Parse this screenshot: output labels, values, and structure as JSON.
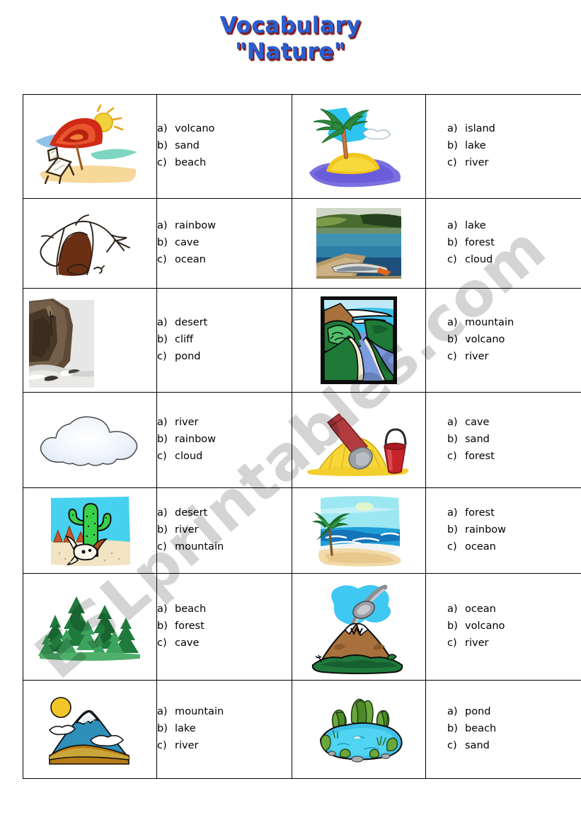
{
  "title": {
    "line1": "Vocabulary",
    "line2": "\"Nature\"",
    "color": "#2a5fd0",
    "shadow_color": "#8d1b1b"
  },
  "watermark": {
    "text": "ESLprintables.com",
    "color": "rgba(0,0,0,0.17)"
  },
  "rows": [
    {
      "left": {
        "image_name": "beach-umbrella-illustration",
        "options": [
          {
            "key": "a)",
            "word": "volcano"
          },
          {
            "key": "b)",
            "word": "sand"
          },
          {
            "key": "c)",
            "word": "beach"
          }
        ]
      },
      "right": {
        "image_name": "island-palm-tree-illustration",
        "options": [
          {
            "key": "a)",
            "word": "island"
          },
          {
            "key": "b)",
            "word": "lake"
          },
          {
            "key": "c)",
            "word": "river"
          }
        ]
      }
    },
    {
      "left": {
        "image_name": "cave-entrance-illustration",
        "options": [
          {
            "key": "a)",
            "word": "rainbow"
          },
          {
            "key": "b)",
            "word": "cave"
          },
          {
            "key": "c)",
            "word": "ocean"
          }
        ]
      },
      "right": {
        "image_name": "lake-canoe-photo",
        "options": [
          {
            "key": "a)",
            "word": "lake"
          },
          {
            "key": "b)",
            "word": "forest"
          },
          {
            "key": "c)",
            "word": "cloud"
          }
        ]
      }
    },
    {
      "left": {
        "image_name": "cliff-coast-photo",
        "options": [
          {
            "key": "a)",
            "word": "desert"
          },
          {
            "key": "b)",
            "word": "cliff"
          },
          {
            "key": "c)",
            "word": "pond"
          }
        ]
      },
      "right": {
        "image_name": "river-valley-illustration",
        "options": [
          {
            "key": "a)",
            "word": "mountain"
          },
          {
            "key": "b)",
            "word": "volcano"
          },
          {
            "key": "c)",
            "word": "river"
          }
        ]
      }
    },
    {
      "left": {
        "image_name": "cloud-illustration",
        "options": [
          {
            "key": "a)",
            "word": "river"
          },
          {
            "key": "b)",
            "word": "rainbow"
          },
          {
            "key": "c)",
            "word": "cloud"
          }
        ]
      },
      "right": {
        "image_name": "sand-pile-shovel-bucket-illustration",
        "options": [
          {
            "key": "a)",
            "word": "cave"
          },
          {
            "key": "b)",
            "word": "sand"
          },
          {
            "key": "c)",
            "word": "forest"
          }
        ]
      }
    },
    {
      "left": {
        "image_name": "desert-cactus-illustration",
        "options": [
          {
            "key": "a)",
            "word": "desert"
          },
          {
            "key": "b)",
            "word": "river"
          },
          {
            "key": "c)",
            "word": "mountain"
          }
        ]
      },
      "right": {
        "image_name": "ocean-beach-palm-illustration",
        "options": [
          {
            "key": "a)",
            "word": "forest"
          },
          {
            "key": "b)",
            "word": "rainbow"
          },
          {
            "key": "c)",
            "word": "ocean"
          }
        ]
      }
    },
    {
      "left": {
        "image_name": "pine-forest-illustration",
        "options": [
          {
            "key": "a)",
            "word": "beach"
          },
          {
            "key": "b)",
            "word": "forest"
          },
          {
            "key": "c)",
            "word": "cave"
          }
        ]
      },
      "right": {
        "image_name": "volcano-eruption-illustration",
        "options": [
          {
            "key": "a)",
            "word": "ocean"
          },
          {
            "key": "b)",
            "word": "volcano"
          },
          {
            "key": "c)",
            "word": "river"
          }
        ]
      }
    },
    {
      "left": {
        "image_name": "mountain-sun-illustration",
        "options": [
          {
            "key": "a)",
            "word": "mountain"
          },
          {
            "key": "b)",
            "word": "lake"
          },
          {
            "key": "c)",
            "word": "river"
          }
        ]
      },
      "right": {
        "image_name": "pond-illustration",
        "options": [
          {
            "key": "a)",
            "word": "pond"
          },
          {
            "key": "b)",
            "word": "beach"
          },
          {
            "key": "c)",
            "word": "sand"
          }
        ]
      }
    }
  ]
}
